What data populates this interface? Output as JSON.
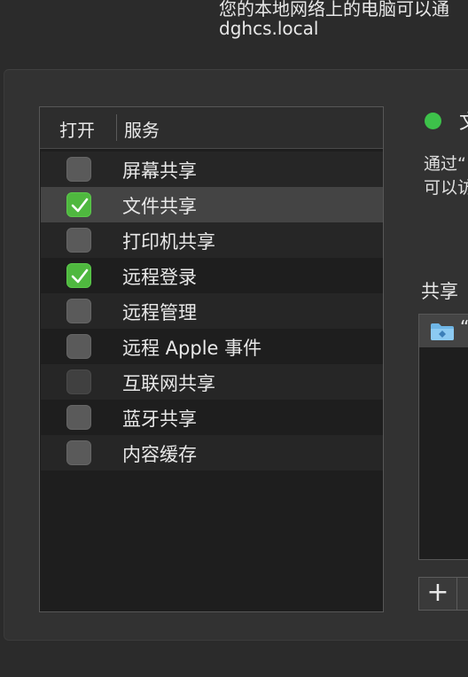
{
  "header": {
    "line1": "您的本地网络上的电脑可以通",
    "line2": "dghcs.local"
  },
  "table": {
    "col_open": "打开",
    "col_service": "服务",
    "services": [
      {
        "label": "屏幕共享",
        "checked": false
      },
      {
        "label": "文件共享",
        "checked": true,
        "selected": true
      },
      {
        "label": "打印机共享",
        "checked": false
      },
      {
        "label": "远程登录",
        "checked": true
      },
      {
        "label": "远程管理",
        "checked": false
      },
      {
        "label": "远程 Apple 事件",
        "checked": false
      },
      {
        "label": "互联网共享",
        "checked": false,
        "disabled": true
      },
      {
        "label": "蓝牙共享",
        "checked": false
      },
      {
        "label": "内容缓存",
        "checked": false
      }
    ]
  },
  "detail": {
    "status_text": "文",
    "status_color": "#3dc24a",
    "desc_line1": "通过“",
    "desc_line2": "可以访",
    "shared_folders_label": "共享",
    "shared_folder_name": "“",
    "add_label": "+"
  }
}
